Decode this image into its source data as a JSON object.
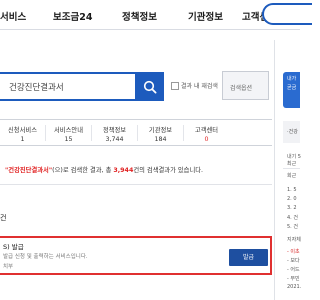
{
  "nav": {
    "items": [
      "서비스",
      "보조금24",
      "정책정보",
      "기관정보",
      "고객센터"
    ]
  },
  "search": {
    "query": "건강진단결과서",
    "within_label": "결과 내 재검색",
    "options_label": "검색옵션"
  },
  "categories": [
    {
      "label": "신청서비스",
      "count": "1"
    },
    {
      "label": "서비스안내",
      "count": "15"
    },
    {
      "label": "정책정보",
      "count": "3,744"
    },
    {
      "label": "기관정보",
      "count": "184"
    },
    {
      "label": "고객센터",
      "count": "0"
    }
  ],
  "result": {
    "keyword": "\"건강진단결과서\"",
    "prefix": "(으)로 검색한 결과, 총 ",
    "total": "3,944",
    "suffix": "건의 검색결과가 있습니다."
  },
  "section": {
    "title": "건"
  },
  "card": {
    "title": "S) 발급",
    "desc": "발급 신청 및 출력하는 서비스입니다.",
    "org": "치부",
    "button": "발급"
  },
  "rail": {
    "blue_line1": "내가",
    "blue_line2": "곧금",
    "gray_label": "·건강",
    "lines": [
      "내기 5",
      "최근",
      "회근",
      "1. 5",
      "2. 0",
      "3. 2",
      "4. 건",
      "5. 건",
      "지자체",
      "- 이초",
      "- 보다",
      "- 어드",
      "- 무민",
      "2021."
    ]
  },
  "colors": {
    "primary": "#1d5bbd",
    "highlight_red": "#e02020",
    "button_dark": "#1e4fa0"
  }
}
